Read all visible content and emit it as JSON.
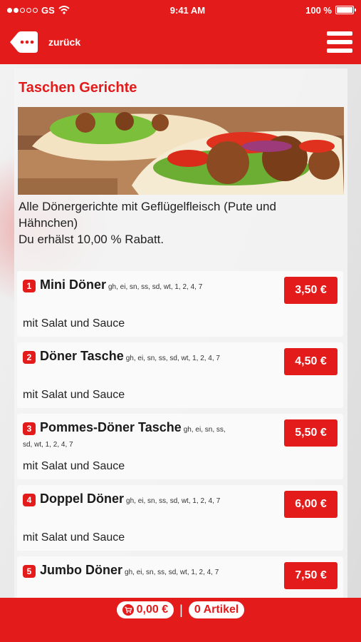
{
  "status_bar": {
    "carrier": "GS",
    "time": "9:41 AM",
    "battery": "100 %"
  },
  "nav": {
    "back_label": "zurück"
  },
  "category": {
    "title": "Taschen Gerichte",
    "description_line1": "Alle Dönergerichte mit Geflügelfleisch (Pute und Hähnchen)",
    "description_line2": "Du erhälst 10,00 % Rabatt."
  },
  "items": [
    {
      "num": "1",
      "name": "Mini Döner",
      "allergens": "gh, ei, sn, ss, sd, wt, 1, 2, 4, 7",
      "sub": "mit Salat und Sauce",
      "price": "3,50 €"
    },
    {
      "num": "2",
      "name": "Döner Tasche",
      "allergens": "gh, ei, sn, ss, sd, wt, 1, 2, 4, 7",
      "sub": "mit Salat und Sauce",
      "price": "4,50 €"
    },
    {
      "num": "3",
      "name": "Pommes-Döner Tasche",
      "allergens": "gh, ei, sn, ss, sd, wt, 1, 2, 4, 7",
      "sub": "mit Salat und Sauce",
      "price": "5,50 €"
    },
    {
      "num": "4",
      "name": "Doppel Döner",
      "allergens": "gh, ei, sn, ss, sd, wt, 1, 2, 4, 7",
      "sub": "mit Salat und Sauce",
      "price": "6,00 €"
    },
    {
      "num": "5",
      "name": "Jumbo Döner",
      "allergens": "gh, ei, sn, ss, sd, wt, 1, 2, 4, 7",
      "sub": "",
      "price": "7,50 €"
    }
  ],
  "cart": {
    "total": "0,00 €",
    "separator": "|",
    "count": "0 Artikel"
  },
  "colors": {
    "brand_red": "#e31b1b",
    "card_bg": "#fafafa"
  },
  "icons": {
    "back": "back-tag-icon",
    "menu": "hamburger-menu-icon",
    "cart": "cart-icon"
  }
}
